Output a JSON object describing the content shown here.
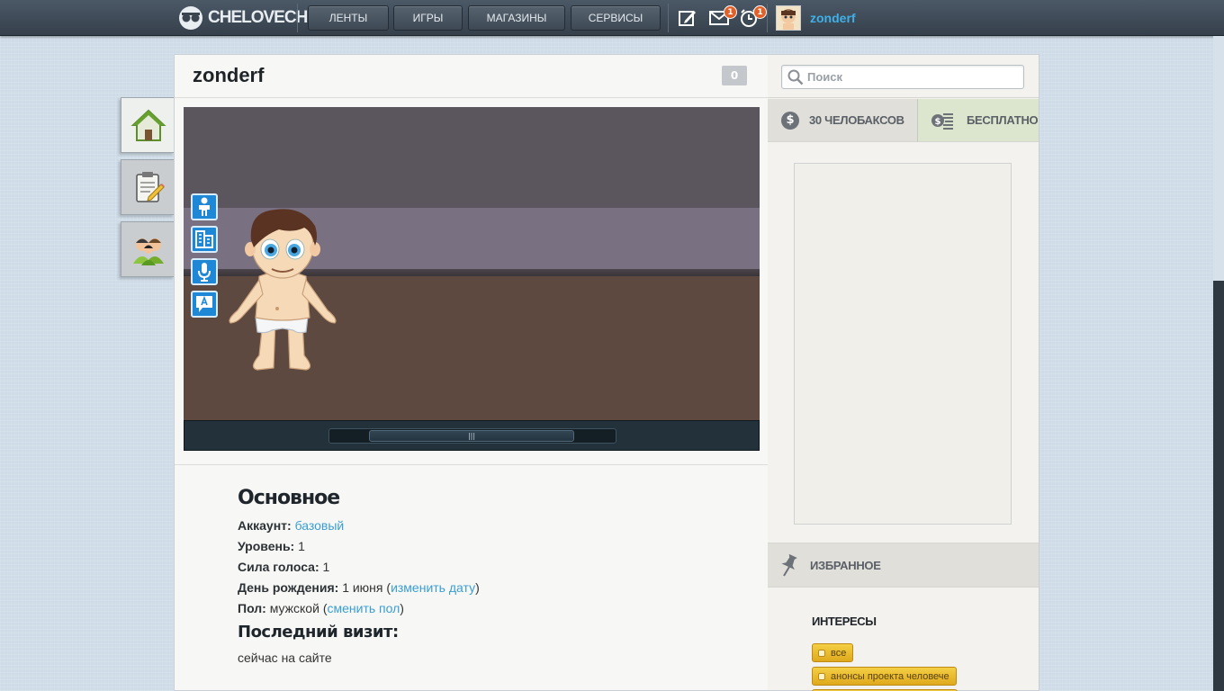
{
  "topbar": {
    "logo_text": "CHELOVECHE",
    "nav": [
      "ЛЕНТЫ",
      "ИГРЫ",
      "МАГАЗИНЫ",
      "СЕРВИСЫ"
    ],
    "messages_badge": "1",
    "notifications_badge": "1",
    "username": "zonderf"
  },
  "profile": {
    "name": "zonderf",
    "counter": "0"
  },
  "scene": {
    "slider_grip": "|||"
  },
  "info": {
    "section_title": "Основное",
    "account_label": "Аккаунт:",
    "account_value": "базовый",
    "level_label": "Уровень:",
    "level_value": "1",
    "vote_label": "Сила голоса:",
    "vote_value": "1",
    "birthday_label": "День рождения:",
    "birthday_value": "1 июня",
    "birthday_open": "(",
    "birthday_link": "изменить дату",
    "birthday_close": ")",
    "gender_label": "Пол:",
    "gender_value": "мужской",
    "gender_open": "(",
    "gender_link": "сменить пол",
    "gender_close": ")",
    "last_visit_title": "Последний визит:",
    "last_visit_value": "сейчас на сайте"
  },
  "sidebar": {
    "search_placeholder": "Поиск",
    "currency_symbol": "$",
    "currency_amount": "30 ЧЕЛОБАКСОВ",
    "free_label": "БЕСПЛАТНО",
    "favorites_label": "ИЗБРАННОЕ",
    "interests_title": "ИНТЕРЕСЫ",
    "tags": [
      "все",
      "анонсы проекта человече"
    ]
  },
  "colors": {
    "accent": "#3fb0e8",
    "badge": "#e0622a",
    "link": "#3b9ed3",
    "tag": "#f4cf45"
  }
}
